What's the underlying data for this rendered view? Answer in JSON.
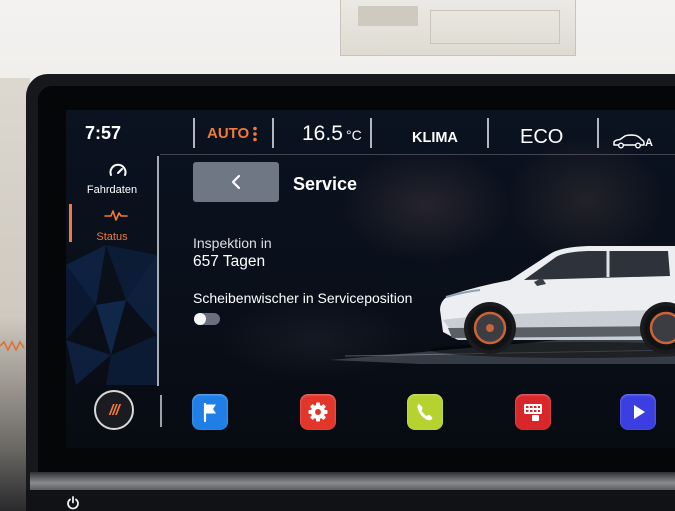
{
  "status_bar": {
    "time": "7:57",
    "climate_mode": "AUTO",
    "climate_menu_icon": "vertical-dots-icon",
    "temperature": "16.5",
    "temperature_unit": "°C",
    "klima_label": "KLIMA",
    "eco_label": "ECO",
    "car_icon": "car-icon",
    "car_label": "A"
  },
  "sidebar": {
    "items": [
      {
        "label": "Fahrdaten",
        "icon": "gauge-icon",
        "active": false
      },
      {
        "label": "Status",
        "icon": "pulse-icon",
        "active": true
      }
    ]
  },
  "main": {
    "back_icon": "chevron-left-icon",
    "title": "Service",
    "inspection_label": "Inspektion in",
    "inspection_value": "657 Tagen",
    "wiper_label": "Scheibenwischer in Serviceposition",
    "wiper_toggle_on": false
  },
  "dock": {
    "home_logo": "///",
    "apps": [
      {
        "icon": "navigation-flag-icon",
        "color": "#1f7fe6"
      },
      {
        "icon": "settings-gear-icon",
        "color": "#e2362b"
      },
      {
        "icon": "phone-icon",
        "color": "#b6d22e"
      },
      {
        "icon": "media-keypad-icon",
        "color": "#d9262b"
      },
      {
        "icon": "play-icon",
        "color": "#3b3fe2"
      }
    ]
  },
  "colors": {
    "accent": "#f07a3a",
    "text": "#ffffff",
    "display_background": "#0b1220",
    "back_button": "#6f7785"
  }
}
